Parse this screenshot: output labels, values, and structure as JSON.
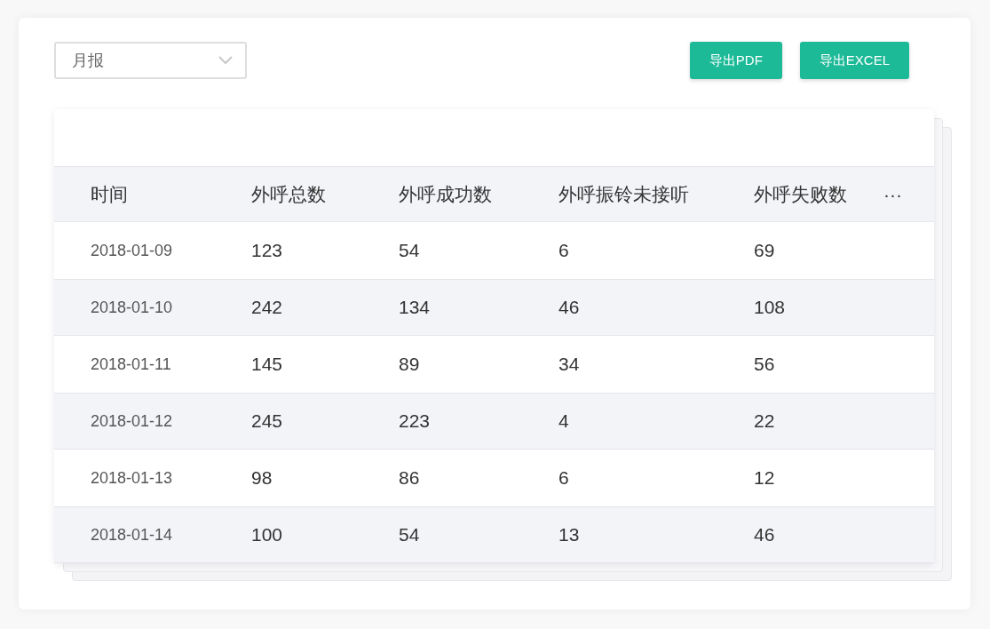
{
  "report_select": {
    "value": "月报"
  },
  "buttons": [
    {
      "label": "导出PDF"
    },
    {
      "label": "导出EXCEL"
    }
  ],
  "table": {
    "columns": [
      "时间",
      "外呼总数",
      "外呼成功数",
      "外呼振铃未接听",
      "外呼失败数",
      "···"
    ],
    "rows": [
      [
        "2018-01-09",
        "123",
        "54",
        "6",
        "69"
      ],
      [
        "2018-01-10",
        "242",
        "134",
        "46",
        "108"
      ],
      [
        "2018-01-11",
        "145",
        "89",
        "34",
        "56"
      ],
      [
        "2018-01-12",
        "245",
        "223",
        "4",
        "22"
      ],
      [
        "2018-01-13",
        "98",
        "86",
        "6",
        "12"
      ],
      [
        "2018-01-14",
        "100",
        "54",
        "13",
        "46"
      ]
    ]
  }
}
